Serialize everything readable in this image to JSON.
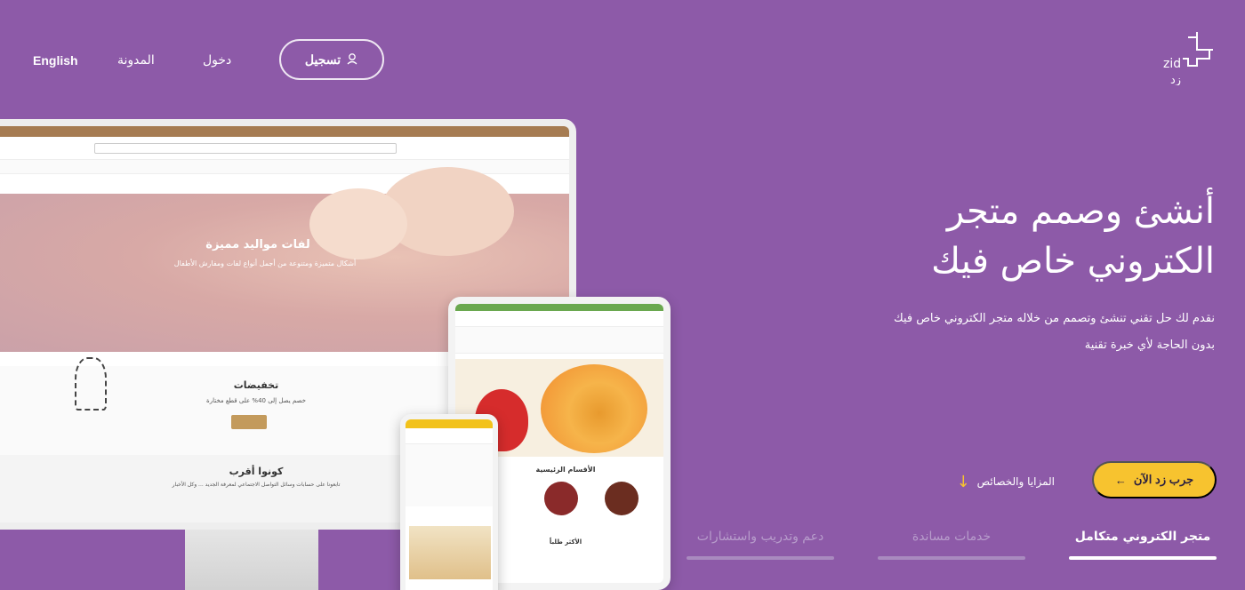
{
  "nav": {
    "english": "English",
    "blog": "المدونة",
    "login": "دخول",
    "register": "تسجيل",
    "register_icon": "user-icon"
  },
  "logo": {
    "latin": "zid",
    "arabic": "زد"
  },
  "hero": {
    "title_line1": "أنشئ وصمم متجر",
    "title_line2": "الكتروني خاص فيك",
    "desc_line1": "نقدم لك حل تقني تنشئ وتصمم من خلاله متجر الكتروني خاص فيك",
    "desc_line2": "بدون الحاجة لأي خبرة تقنية"
  },
  "cta": {
    "label": "جرب زد الآن",
    "arrow": "←"
  },
  "features": {
    "label": "المزايا والخصائص",
    "arrow": "↓"
  },
  "tabs": [
    {
      "label": "متجر الكتروني متكامل",
      "active": true
    },
    {
      "label": "خدمات مساندة",
      "active": false
    },
    {
      "label": "دعم وتدريب واستشارات",
      "active": false
    }
  ],
  "monitor": {
    "hero_title": "لفات مواليد مميزة",
    "hero_sub": "أشكال متميزة ومتنوعة من أجمل أنواع لفات ومفارش الأطفال",
    "sale_title": "تخفيضات",
    "sale_sub": "خصم يصل إلى 40% على قطع مختارة",
    "near_title": "كونوا أقرب",
    "near_sub": "تابعونا على حسابات وسائل التواصل الاجتماعي لمعرفة الجديد ... وكل الأخبار"
  },
  "tablet": {
    "cats_title": "الأقسام الرئيسية",
    "best_title": "الأكثر طلباً"
  },
  "colors": {
    "background": "#8d5aa8",
    "accent": "#f7c32f",
    "text": "#ffffff",
    "tab_inactive": "#b79ccb"
  }
}
